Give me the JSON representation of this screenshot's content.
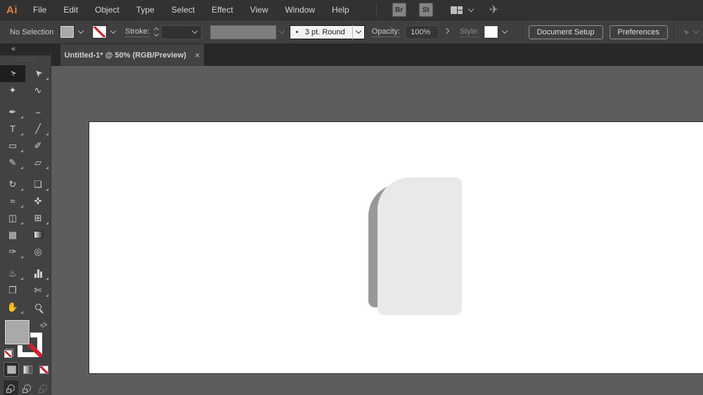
{
  "menu_bar": {
    "logo_text": "Ai",
    "items": [
      "File",
      "Edit",
      "Object",
      "Type",
      "Select",
      "Effect",
      "View",
      "Window",
      "Help"
    ],
    "bridge_label": "Br",
    "stock_label": "St"
  },
  "control_bar": {
    "no_selection_label": "No Selection",
    "stroke_label": "Stroke:",
    "brush_definition_value": "3 pt. Round",
    "opacity_label": "Opacity:",
    "opacity_value": "100%",
    "style_label": "Style:",
    "document_setup_label": "Document Setup",
    "preferences_label": "Preferences"
  },
  "document_tab": {
    "title": "Untitled-1* @ 50% (RGB/Preview)",
    "close_glyph": "×"
  },
  "toolbar": {
    "collapse_glyph": "«",
    "selected_tool": "selection-tool",
    "gaps_after_rows": [
      1,
      5,
      10
    ],
    "rows": [
      [
        {
          "name": "selection-tool",
          "glyph": "➢",
          "rot": -135,
          "selected": true
        },
        {
          "name": "direct-selection-tool",
          "glyph": "➤",
          "rot": -135,
          "flyout": true
        }
      ],
      [
        {
          "name": "magic-wand-tool",
          "glyph": "✦"
        },
        {
          "name": "lasso-tool",
          "glyph": "∿"
        }
      ],
      [
        {
          "name": "pen-tool",
          "glyph": "✒",
          "flyout": true
        },
        {
          "name": "curvature-tool",
          "glyph": "⌣"
        }
      ],
      [
        {
          "name": "type-tool",
          "glyph": "T",
          "flyout": true
        },
        {
          "name": "line-segment-tool",
          "glyph": "╱",
          "flyout": true
        }
      ],
      [
        {
          "name": "rectangle-tool",
          "glyph": "▭",
          "flyout": true
        },
        {
          "name": "paintbrush-tool",
          "glyph": "✐"
        }
      ],
      [
        {
          "name": "pencil-tool",
          "glyph": "✎",
          "flyout": true
        },
        {
          "name": "eraser-tool",
          "glyph": "▱",
          "flyout": true
        }
      ],
      [
        {
          "name": "rotate-tool",
          "glyph": "↻",
          "flyout": true
        },
        {
          "name": "scale-tool",
          "glyph": "❏",
          "flyout": true
        }
      ],
      [
        {
          "name": "width-tool",
          "glyph": "≈",
          "flyout": true
        },
        {
          "name": "puppet-warp-tool",
          "glyph": "✜"
        }
      ],
      [
        {
          "name": "shape-builder-tool",
          "glyph": "◫",
          "flyout": true
        },
        {
          "name": "perspective-grid-tool",
          "glyph": "⊞",
          "flyout": true
        }
      ],
      [
        {
          "name": "mesh-tool",
          "glyph": "▦"
        },
        {
          "name": "gradient-tool",
          "type": "gradient"
        }
      ],
      [
        {
          "name": "eyedropper-tool",
          "glyph": "✑",
          "flyout": true
        },
        {
          "name": "blend-tool",
          "glyph": "◎"
        }
      ],
      [
        {
          "name": "symbol-sprayer-tool",
          "glyph": "♨",
          "flyout": true
        },
        {
          "name": "column-graph-tool",
          "type": "bars",
          "flyout": true
        }
      ],
      [
        {
          "name": "artboard-tool",
          "glyph": "❐"
        },
        {
          "name": "slice-tool",
          "glyph": "✄",
          "flyout": true
        }
      ],
      [
        {
          "name": "hand-tool",
          "glyph": "✋",
          "flyout": true
        },
        {
          "name": "zoom-tool",
          "type": "magnifier"
        }
      ]
    ]
  },
  "canvas": {
    "shape_front_color": "#e9e9ea",
    "shape_back_color": "#98989c",
    "artboard_color": "#ffffff",
    "pasteboard_color": "#5d5d5d"
  },
  "colors": {
    "logo_orange": "#e0823c",
    "accent_red": "#cf2030",
    "fill_swatch_gray": "#a9a9a9",
    "ui_dark": "#323232",
    "ui_panel": "#424242"
  }
}
